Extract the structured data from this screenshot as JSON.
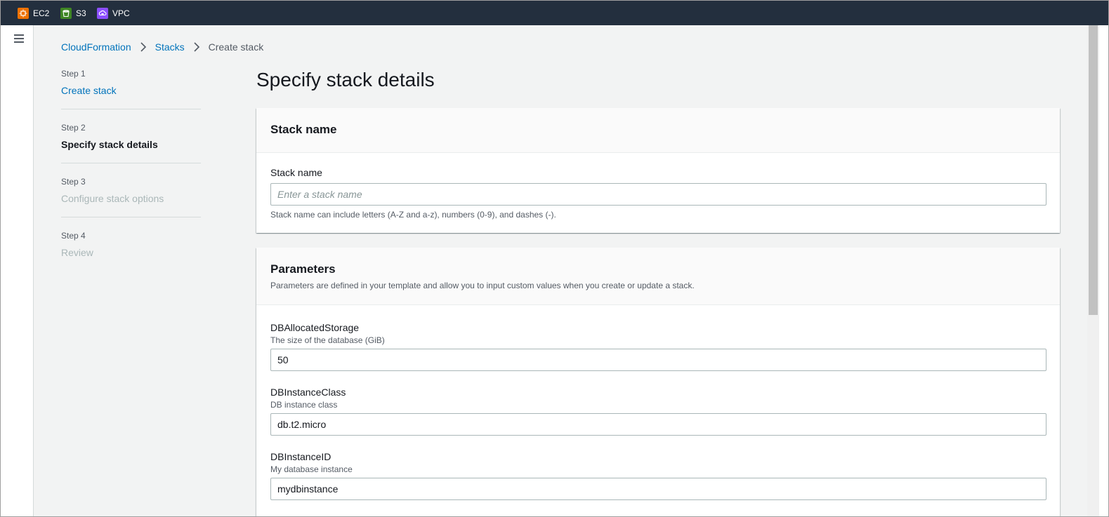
{
  "topbar": {
    "favorites": [
      {
        "label": "EC2",
        "icon": "ec2-icon",
        "color": "#ed7100"
      },
      {
        "label": "S3",
        "icon": "s3-bucket-icon",
        "color": "#3f8624"
      },
      {
        "label": "VPC",
        "icon": "vpc-icon",
        "color": "#8c4fff"
      }
    ]
  },
  "breadcrumb": {
    "items": [
      "CloudFormation",
      "Stacks",
      "Create stack"
    ]
  },
  "wizard": {
    "steps": [
      {
        "num": "Step 1",
        "name": "Create stack",
        "state": "link"
      },
      {
        "num": "Step 2",
        "name": "Specify stack details",
        "state": "active"
      },
      {
        "num": "Step 3",
        "name": "Configure stack options",
        "state": "disabled"
      },
      {
        "num": "Step 4",
        "name": "Review",
        "state": "disabled"
      }
    ]
  },
  "page": {
    "title": "Specify stack details"
  },
  "stack_name_panel": {
    "header": "Stack name",
    "label": "Stack name",
    "placeholder": "Enter a stack name",
    "value": "",
    "hint": "Stack name can include letters (A-Z and a-z), numbers (0-9), and dashes (-)."
  },
  "parameters_panel": {
    "header": "Parameters",
    "description": "Parameters are defined in your template and allow you to input custom values when you create or update a stack.",
    "fields": [
      {
        "label": "DBAllocatedStorage",
        "desc": "The size of the database (GiB)",
        "value": "50"
      },
      {
        "label": "DBInstanceClass",
        "desc": "DB instance class",
        "value": "db.t2.micro"
      },
      {
        "label": "DBInstanceID",
        "desc": "My database instance",
        "value": "mydbinstance"
      }
    ]
  },
  "colors": {
    "topbar": "#232f3e",
    "link": "#0073bb",
    "background": "#f2f3f3"
  }
}
